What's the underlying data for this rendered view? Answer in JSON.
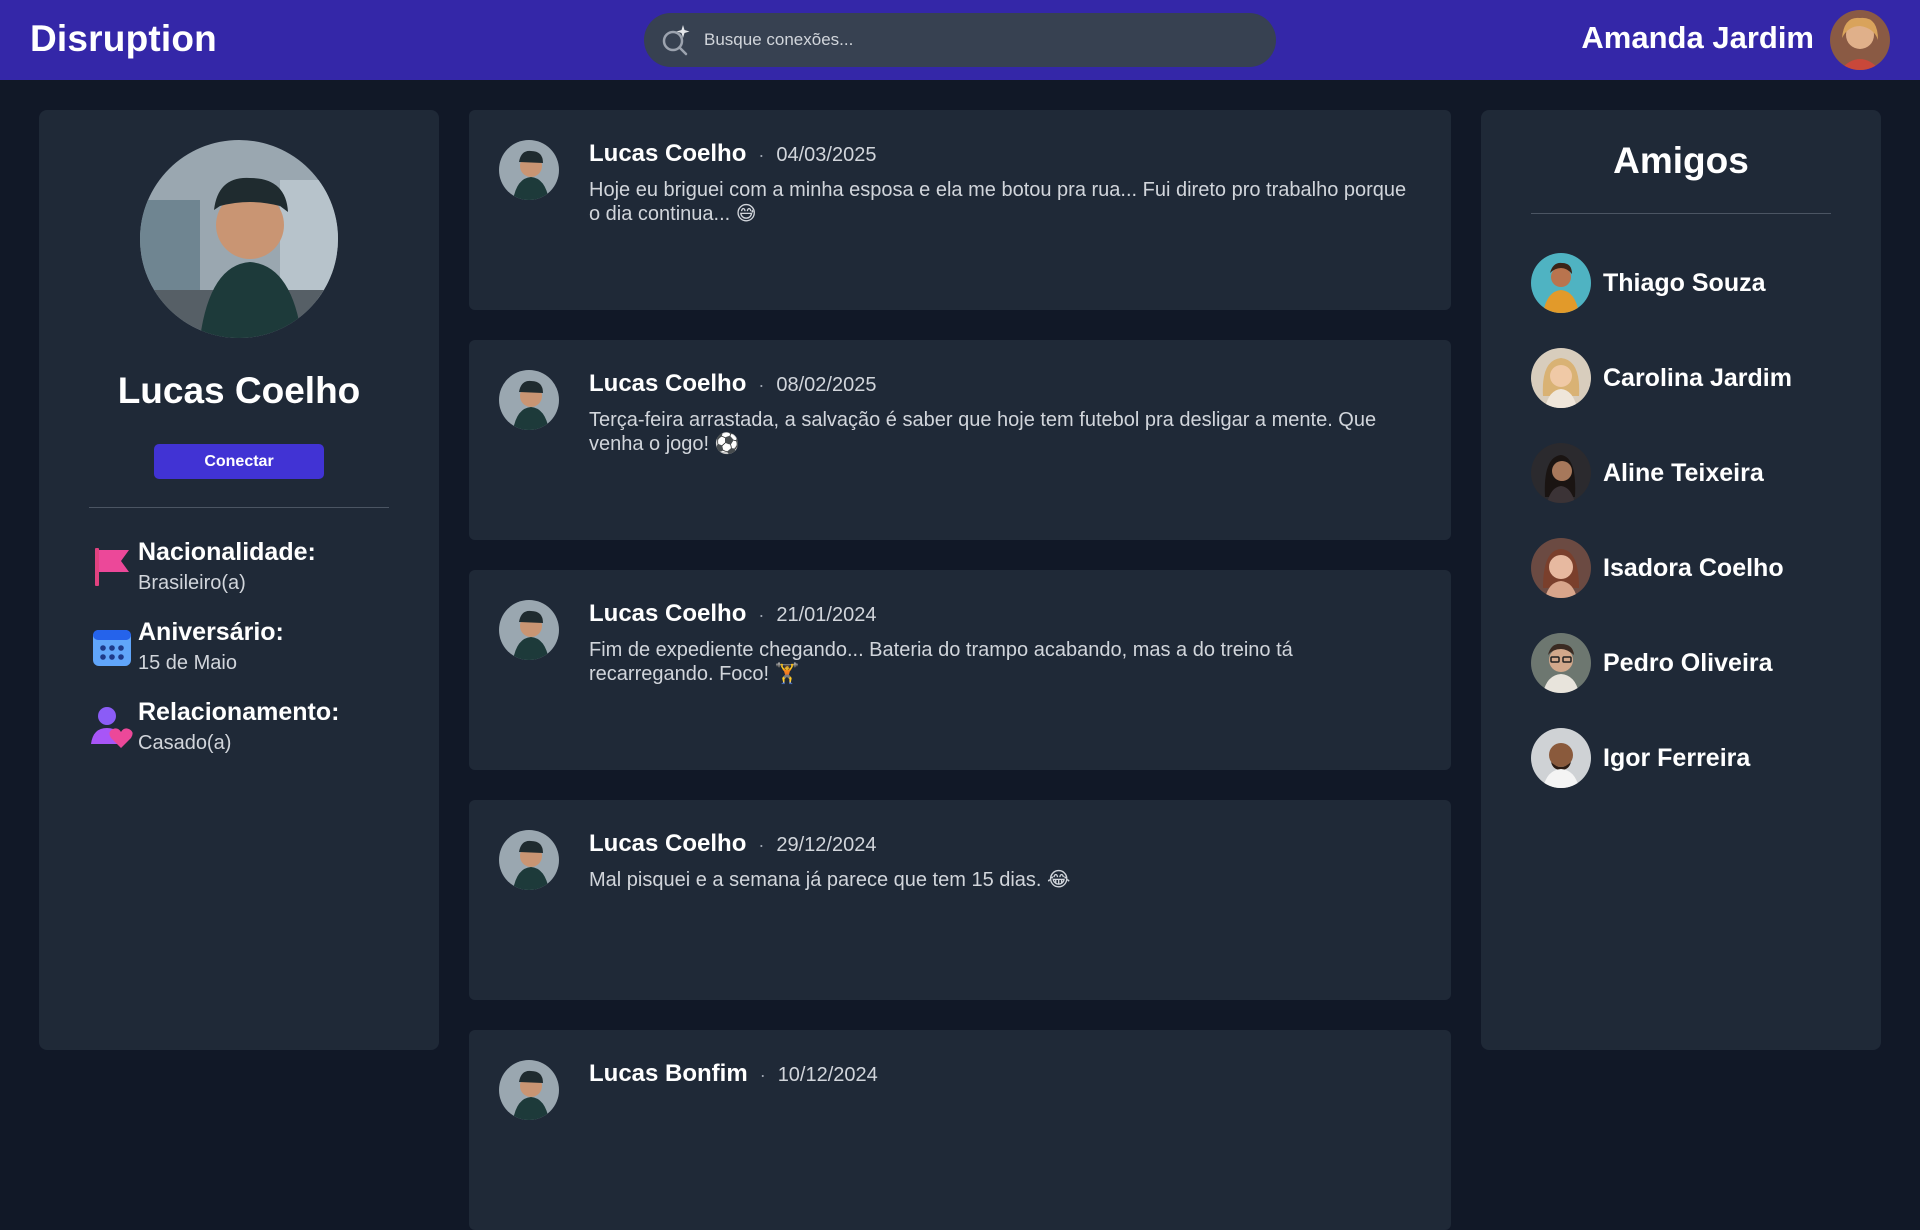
{
  "header": {
    "brand": "Disruption",
    "search_placeholder": "Busque conexões...",
    "user_name": "Amanda Jardim",
    "accent": "#3427a8"
  },
  "profile": {
    "name": "Lucas Coelho",
    "connect_label": "Conectar",
    "info": [
      {
        "icon": "flag-icon",
        "label": "Nacionalidade:",
        "value": "Brasileiro(a)"
      },
      {
        "icon": "calendar-icon",
        "label": "Aniversário:",
        "value": "15 de Maio"
      },
      {
        "icon": "relationship-icon",
        "label": "Relacionamento:",
        "value": "Casado(a)"
      }
    ]
  },
  "feed": {
    "separator": "·",
    "posts": [
      {
        "author": "Lucas Coelho",
        "date": "04/03/2025",
        "text": "Hoje eu briguei com a minha esposa e ela me botou pra rua... Fui direto pro trabalho porque o dia continua... 😅"
      },
      {
        "author": "Lucas Coelho",
        "date": "08/02/2025",
        "text": "Terça-feira arrastada, a salvação é saber que hoje tem futebol pra desligar a mente. Que venha o jogo! ⚽"
      },
      {
        "author": "Lucas Coelho",
        "date": "21/01/2024",
        "text": "Fim de expediente chegando... Bateria do trampo acabando, mas a do treino tá recarregando. Foco! 🏋"
      },
      {
        "author": "Lucas Coelho",
        "date": "29/12/2024",
        "text": "Mal pisquei e a semana já parece que tem 15 dias. 😂"
      },
      {
        "author": "Lucas Bonfim",
        "date": "10/12/2024",
        "text": ""
      }
    ]
  },
  "friends": {
    "title": "Amigos",
    "items": [
      {
        "name": "Thiago Souza"
      },
      {
        "name": "Carolina Jardim"
      },
      {
        "name": "Aline Teixeira"
      },
      {
        "name": "Isadora Coelho"
      },
      {
        "name": "Pedro Oliveira"
      },
      {
        "name": "Igor Ferreira"
      }
    ]
  }
}
